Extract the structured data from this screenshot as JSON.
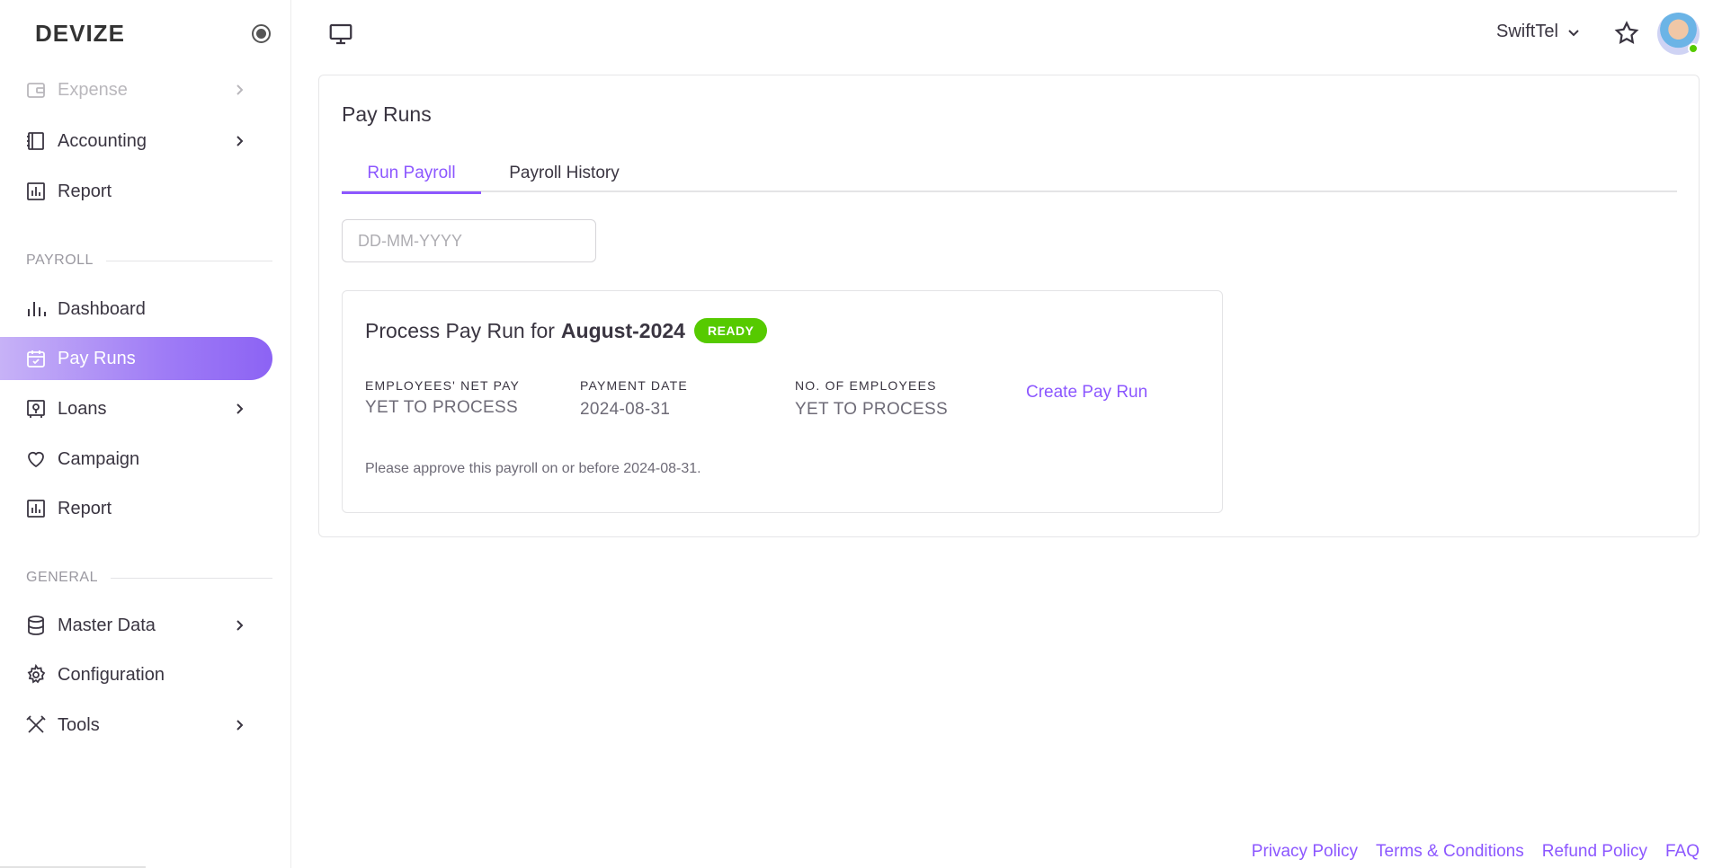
{
  "brand": "DEVIZE",
  "sidebar": {
    "top_items": [
      {
        "label": "Expense",
        "icon": "wallet-icon"
      },
      {
        "label": "Accounting",
        "icon": "ledger-icon"
      },
      {
        "label": "Report",
        "icon": "report-icon"
      }
    ],
    "payroll_section": "PAYROLL",
    "payroll_items": [
      {
        "label": "Dashboard",
        "icon": "bar-chart-icon"
      },
      {
        "label": "Pay Runs",
        "icon": "calendar-check-icon"
      },
      {
        "label": "Loans",
        "icon": "loan-icon"
      },
      {
        "label": "Campaign",
        "icon": "heart-icon"
      },
      {
        "label": "Report",
        "icon": "report-icon"
      }
    ],
    "general_section": "GENERAL",
    "general_items": [
      {
        "label": "Master Data",
        "icon": "database-icon"
      },
      {
        "label": "Configuration",
        "icon": "gear-icon"
      },
      {
        "label": "Tools",
        "icon": "tools-icon"
      }
    ]
  },
  "header": {
    "company": "SwiftTel"
  },
  "main": {
    "title": "Pay Runs",
    "tabs": [
      {
        "label": "Run Payroll",
        "active": true
      },
      {
        "label": "Payroll History",
        "active": false
      }
    ],
    "date_placeholder": "DD-MM-YYYY",
    "pay_run": {
      "title_prefix": "Process Pay Run for",
      "period": "August-2024",
      "status": "READY",
      "net_pay_label": "EMPLOYEES' NET PAY",
      "net_pay_value": "YET TO PROCESS",
      "payment_date_label": "PAYMENT DATE",
      "payment_date_value": "2024-08-31",
      "employees_label": "NO. OF EMPLOYEES",
      "employees_value": "YET TO PROCESS",
      "create_label": "Create Pay Run",
      "note": "Please approve this payroll on or before 2024-08-31."
    }
  },
  "footer": {
    "links": [
      "Privacy Policy",
      "Terms & Conditions",
      "Refund Policy",
      "FAQ"
    ]
  },
  "colors": {
    "accent": "#8c57ff",
    "ready": "#56ca00"
  }
}
